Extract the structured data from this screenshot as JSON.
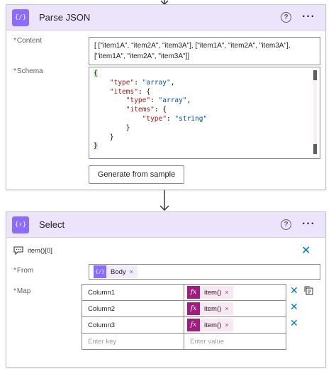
{
  "parse_json": {
    "title": "Parse JSON",
    "icon": "curly-braces-icon",
    "help_label": "?",
    "more_label": "···",
    "content_label": "Content",
    "content_value": "[ [\"item1A\", \"item2A\", \"item3A\"], [\"item1A\", \"item2A\", \"item3A\"],[\"item1A\", \"item2A\", \"item3A\"]]",
    "schema_label": "Schema",
    "schema_lines": [
      "{",
      "    \"type\": \"array\",",
      "    \"items\": {",
      "        \"type\": \"array\",",
      "        \"items\": {",
      "            \"type\": \"string\"",
      "        }",
      "    }",
      "}"
    ],
    "generate_button": "Generate from sample"
  },
  "select": {
    "title": "Select",
    "help_label": "?",
    "more_label": "···",
    "expression_text": "item()[0]",
    "from_label": "From",
    "from_token": "Body",
    "map_label": "Map",
    "map_rows": [
      {
        "key": "Column1",
        "value": "item()"
      },
      {
        "key": "Column2",
        "value": "item()"
      },
      {
        "key": "Column3",
        "value": "item()"
      }
    ],
    "key_placeholder": "Enter key",
    "value_placeholder": "Enter value",
    "required_marker": "*",
    "fx_label": "fx",
    "token_remove": "×",
    "close_glyph": "✕"
  },
  "colors": {
    "header_bg": "#ebe4fb",
    "accent_purple": "#8c6cff",
    "fx_magenta": "#a01c7e",
    "link_blue": "#0078d4"
  }
}
